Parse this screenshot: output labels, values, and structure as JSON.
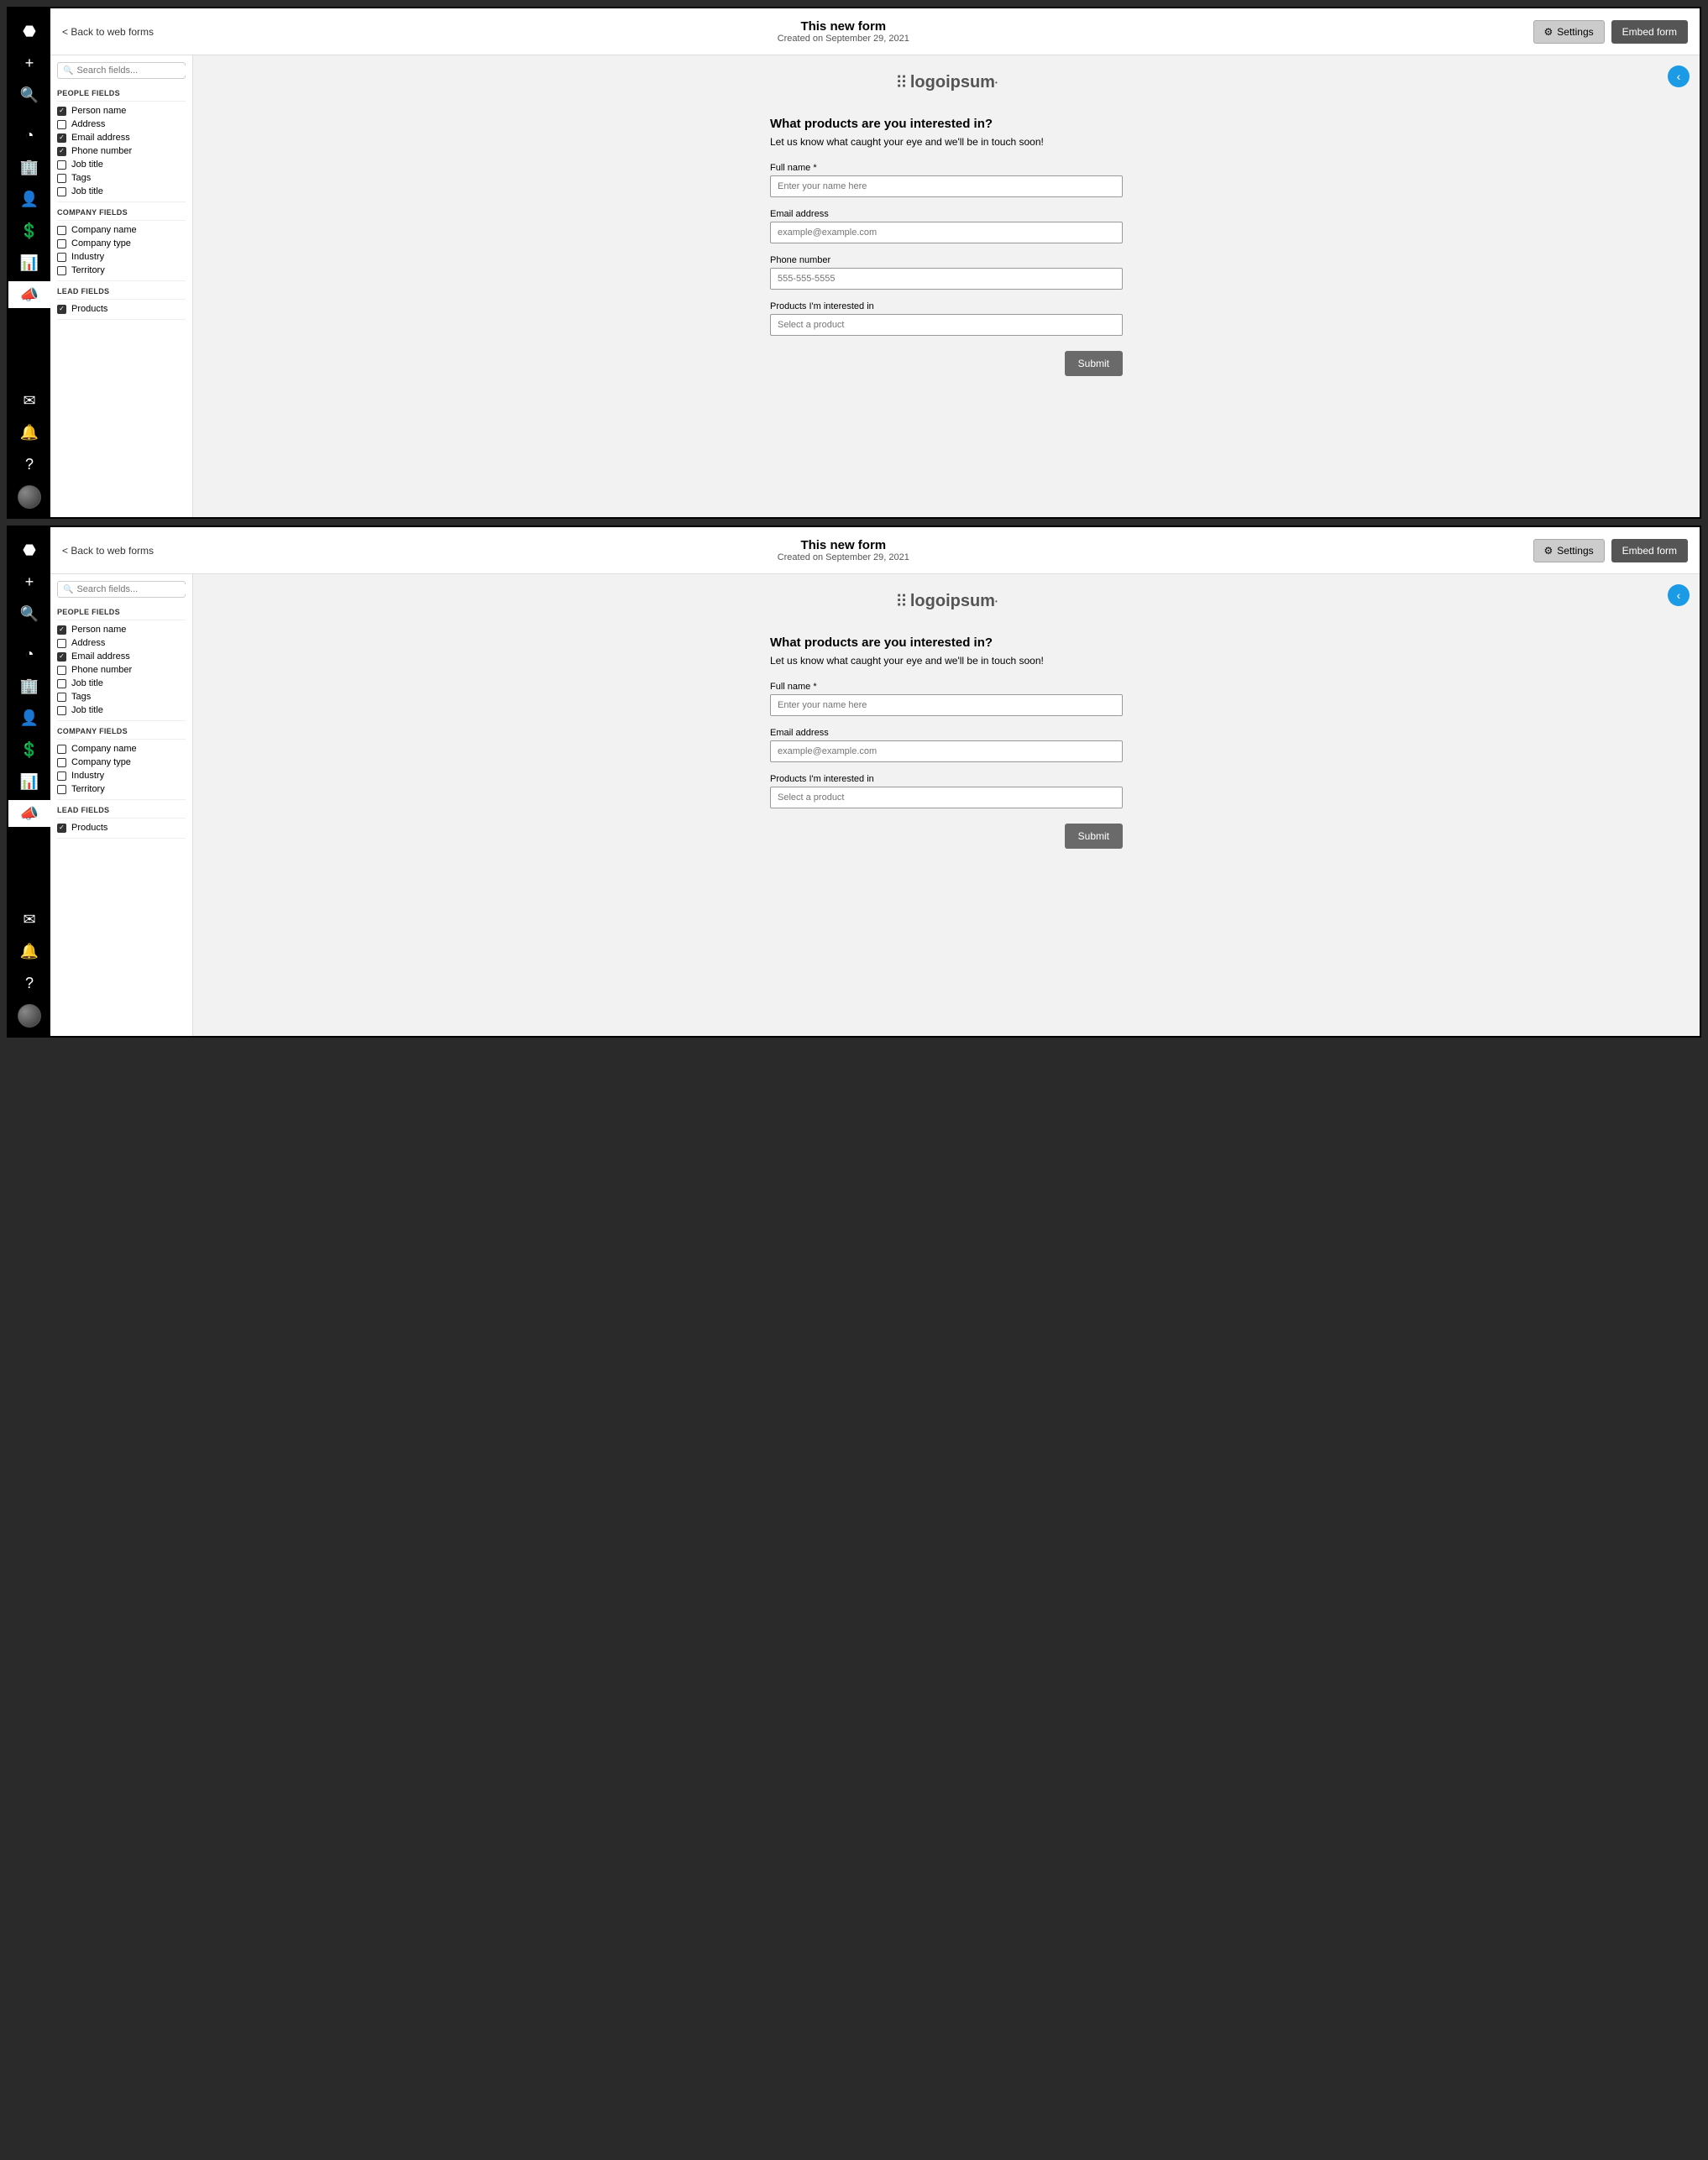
{
  "screens": [
    {
      "back_link": "< Back to web forms",
      "title": "This new form",
      "subtitle": "Created on September 29, 2021",
      "settings_label": "Settings",
      "embed_label": "Embed form",
      "search_placeholder": "Search fields...",
      "sections": [
        {
          "heading": "PEOPLE FIELDS",
          "fields": [
            {
              "label": "Person name",
              "checked": true
            },
            {
              "label": "Address",
              "checked": false
            },
            {
              "label": "Email address",
              "checked": true
            },
            {
              "label": "Phone number",
              "checked": true
            },
            {
              "label": "Job title",
              "checked": false
            },
            {
              "label": "Tags",
              "checked": false
            },
            {
              "label": "Job title",
              "checked": false
            }
          ]
        },
        {
          "heading": "COMPANY FIELDS",
          "fields": [
            {
              "label": "Company name",
              "checked": false
            },
            {
              "label": "Company type",
              "checked": false
            },
            {
              "label": "Industry",
              "checked": false
            },
            {
              "label": "Territory",
              "checked": false
            }
          ]
        },
        {
          "heading": "LEAD FIELDS",
          "fields": [
            {
              "label": "Products",
              "checked": true
            }
          ]
        }
      ],
      "form": {
        "logo_text": "logoipsum",
        "title": "What products are you interested in?",
        "desc": "Let us know what caught your eye and we'll be in touch soon!",
        "fields": [
          {
            "label": "Full name *",
            "placeholder": "Enter your name here",
            "type": "text"
          },
          {
            "label": "Email address",
            "placeholder": "example@example.com",
            "type": "text"
          },
          {
            "label": "Phone number",
            "placeholder": "555-555-5555",
            "type": "text"
          },
          {
            "label": "Products I'm interested in",
            "placeholder": "Select a product",
            "type": "select"
          }
        ],
        "submit_label": "Submit"
      }
    },
    {
      "back_link": "< Back to web forms",
      "title": "This new form",
      "subtitle": "Created on September 29, 2021",
      "settings_label": "Settings",
      "embed_label": "Embed form",
      "search_placeholder": "Search fields...",
      "sections": [
        {
          "heading": "PEOPLE FIELDS",
          "fields": [
            {
              "label": "Person name",
              "checked": true
            },
            {
              "label": "Address",
              "checked": false
            },
            {
              "label": "Email address",
              "checked": true
            },
            {
              "label": "Phone number",
              "checked": false
            },
            {
              "label": "Job title",
              "checked": false
            },
            {
              "label": "Tags",
              "checked": false
            },
            {
              "label": "Job title",
              "checked": false
            }
          ]
        },
        {
          "heading": "COMPANY FIELDS",
          "fields": [
            {
              "label": "Company name",
              "checked": false
            },
            {
              "label": "Company type",
              "checked": false
            },
            {
              "label": "Industry",
              "checked": false
            },
            {
              "label": "Territory",
              "checked": false
            }
          ]
        },
        {
          "heading": "LEAD FIELDS",
          "fields": [
            {
              "label": "Products",
              "checked": true
            }
          ]
        }
      ],
      "form": {
        "logo_text": "logoipsum",
        "title": "What products are you interested in?",
        "desc": "Let us know what caught your eye and we'll be in touch soon!",
        "fields": [
          {
            "label": "Full name *",
            "placeholder": "Enter your name here",
            "type": "text"
          },
          {
            "label": "Email address",
            "placeholder": "example@example.com",
            "type": "text"
          },
          {
            "label": "Products I'm interested in",
            "placeholder": "Select a product",
            "type": "select"
          }
        ],
        "submit_label": "Submit"
      }
    }
  ],
  "nav_icons": [
    {
      "name": "acorn-icon",
      "glyph": "⬣"
    },
    {
      "name": "plus-icon",
      "glyph": "+"
    },
    {
      "name": "search-icon",
      "glyph": "🔍"
    },
    {
      "name": "gauge-icon",
      "glyph": "◔"
    },
    {
      "name": "building-icon",
      "glyph": "🏢"
    },
    {
      "name": "person-icon",
      "glyph": "👤"
    },
    {
      "name": "money-icon",
      "glyph": "💲"
    },
    {
      "name": "chart-icon",
      "glyph": "📊"
    },
    {
      "name": "megaphone-icon",
      "glyph": "📣",
      "active": true
    }
  ],
  "nav_footer": [
    {
      "name": "mail-icon",
      "glyph": "✉"
    },
    {
      "name": "bell-icon",
      "glyph": "🔔"
    },
    {
      "name": "help-icon",
      "glyph": "?"
    }
  ]
}
